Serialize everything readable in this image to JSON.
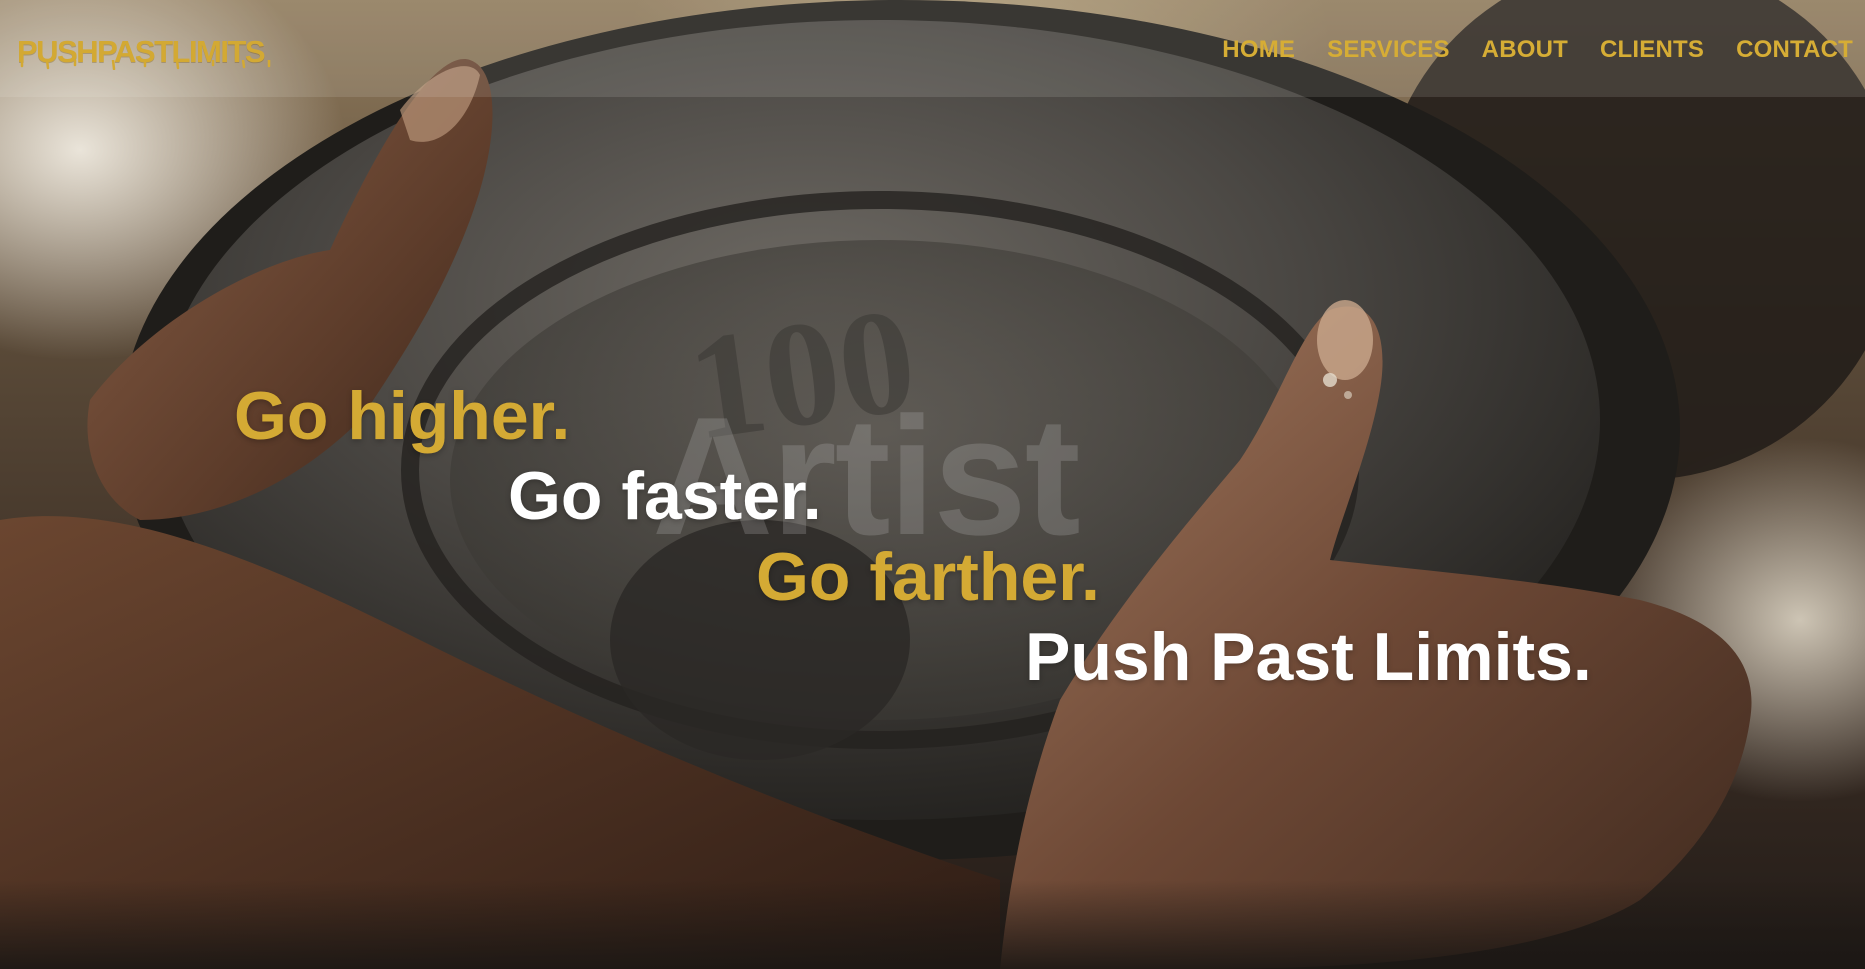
{
  "header": {
    "logo_text": "PUSHPASTLIMITS",
    "nav": [
      {
        "label": "HOME"
      },
      {
        "label": "SERVICES"
      },
      {
        "label": "ABOUT"
      },
      {
        "label": "CLIENTS"
      },
      {
        "label": "CONTACT"
      }
    ]
  },
  "hero": {
    "watermark": "Artist",
    "lines": [
      {
        "text": "Go higher.",
        "color": "#d4aa34"
      },
      {
        "text": "Go faster.",
        "color": "#ffffff"
      },
      {
        "text": "Go farther.",
        "color": "#d4aa34"
      },
      {
        "text": "Push Past Limits.",
        "color": "#ffffff"
      }
    ],
    "plate_engraving": "100"
  },
  "colors": {
    "brand_gold": "#d4aa34",
    "white": "#ffffff"
  }
}
